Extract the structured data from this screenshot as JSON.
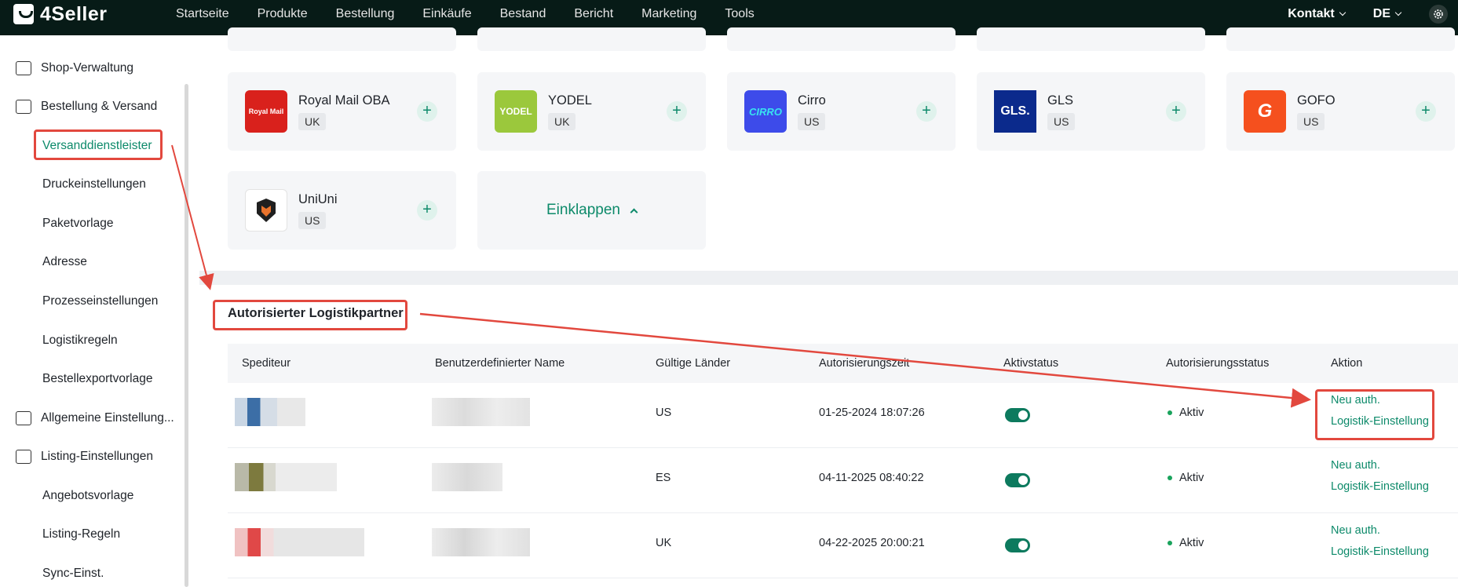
{
  "app": {
    "logo_text": "4Seller"
  },
  "nav": [
    "Startseite",
    "Produkte",
    "Bestellung",
    "Einkäufe",
    "Bestand",
    "Bericht",
    "Marketing",
    "Tools"
  ],
  "top_right": {
    "contact": "Kontakt",
    "language": "DE"
  },
  "sidebar": {
    "items": [
      {
        "label": "Shop-Verwaltung",
        "type": "group",
        "icon": "shop-icon"
      },
      {
        "label": "Bestellung & Versand",
        "type": "group",
        "icon": "order-icon"
      },
      {
        "label": "Versanddienstleister",
        "type": "sub",
        "active": true
      },
      {
        "label": "Druckeinstellungen",
        "type": "sub"
      },
      {
        "label": "Paketvorlage",
        "type": "sub"
      },
      {
        "label": "Adresse",
        "type": "sub"
      },
      {
        "label": "Prozesseinstellungen",
        "type": "sub"
      },
      {
        "label": "Logistikregeln",
        "type": "sub"
      },
      {
        "label": "Bestellexportvorlage",
        "type": "sub"
      },
      {
        "label": "Allgemeine Einstellung...",
        "type": "group",
        "icon": "settings-icon"
      },
      {
        "label": "Listing-Einstellungen",
        "type": "group",
        "icon": "upload-icon"
      },
      {
        "label": "Angebotsvorlage",
        "type": "sub"
      },
      {
        "label": "Listing-Regeln",
        "type": "sub"
      },
      {
        "label": "Sync-Einst.",
        "type": "sub"
      }
    ]
  },
  "carriers": [
    {
      "name": "Royal Mail OBA",
      "region": "UK",
      "logo_text": "Royal Mail",
      "color": "#d9211c"
    },
    {
      "name": "YODEL",
      "region": "UK",
      "logo_text": "YODEL",
      "color": "#9bc83c"
    },
    {
      "name": "Cirro",
      "region": "US",
      "logo_text": "CIRRO",
      "color": "#3d4bea"
    },
    {
      "name": "GLS",
      "region": "US",
      "logo_text": "GLS.",
      "color": "#0b2a8c"
    },
    {
      "name": "GOFO",
      "region": "US",
      "logo_text": "G",
      "color": "#f5501e"
    },
    {
      "name": "UniUni",
      "region": "US",
      "logo_text": "",
      "color": "#ffffff"
    }
  ],
  "collapse_label": "Einklappen",
  "section_title": "Autorisierter Logistikpartner",
  "table": {
    "headers": [
      "Spediteur",
      "Benutzerdefinierter Name",
      "Gültige Länder",
      "Autorisierungszeit",
      "Aktivstatus",
      "Autorisierungsstatus",
      "Aktion"
    ],
    "rows": [
      {
        "country": "US",
        "time": "01-25-2024 18:07:26",
        "status": "Aktiv",
        "action1": "Neu auth.",
        "action2": "Logistik-Einstellung",
        "accent": "#3c6ea6"
      },
      {
        "country": "ES",
        "time": "04-11-2025 08:40:22",
        "status": "Aktiv",
        "action1": "Neu auth.",
        "action2": "Logistik-Einstellung",
        "accent": "#7d7a3e"
      },
      {
        "country": "UK",
        "time": "04-22-2025 20:00:21",
        "status": "Aktiv",
        "action1": "Neu auth.",
        "action2": "Logistik-Einstellung",
        "accent": "#e04848"
      }
    ]
  }
}
